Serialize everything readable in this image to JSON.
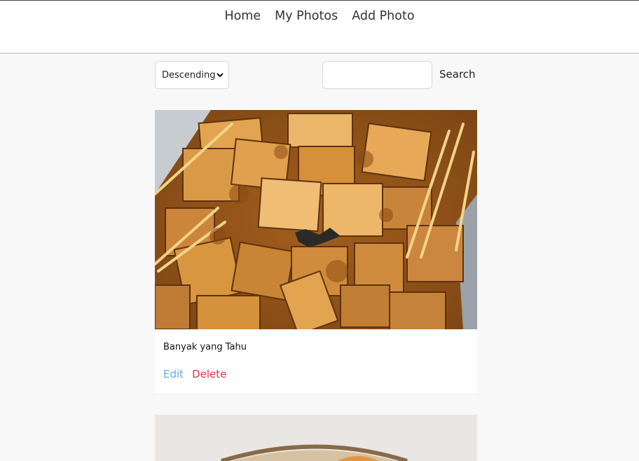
{
  "nav": {
    "items": [
      {
        "label": "Home"
      },
      {
        "label": "My Photos"
      },
      {
        "label": "Add Photo"
      }
    ]
  },
  "toolbar": {
    "sort_selected": "Descending",
    "search_value": "",
    "search_label": "Search"
  },
  "photos": [
    {
      "caption": "Banyak yang Tahu",
      "edit_label": "Edit",
      "delete_label": "Delete"
    }
  ],
  "colors": {
    "edit": "#63a9dd",
    "delete": "#dc3545",
    "background": "#f8f8f8"
  }
}
